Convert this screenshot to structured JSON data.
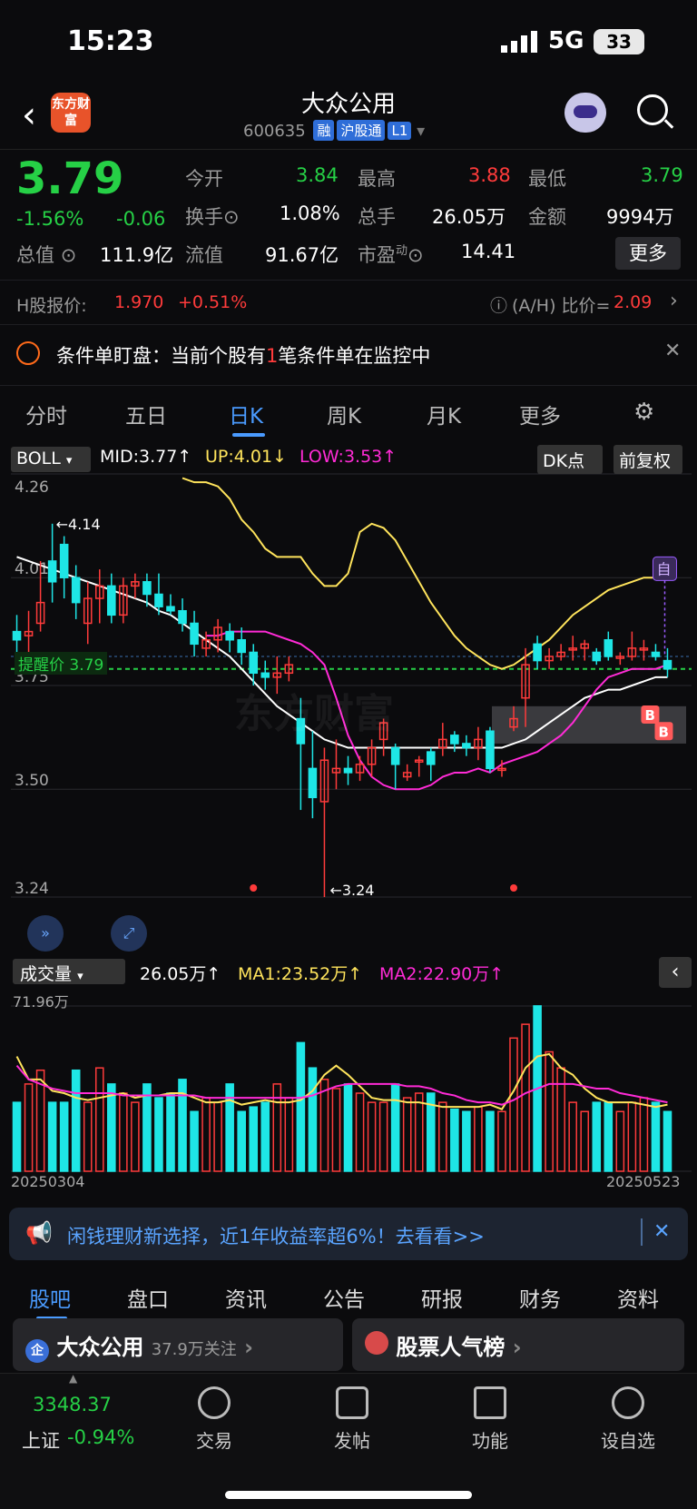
{
  "status": {
    "time": "15:23",
    "network": "5G",
    "battery": "33"
  },
  "header": {
    "logo_text": "东方财富",
    "stock_name": "大众公用",
    "stock_code": "600635",
    "tags": [
      "融",
      "沪股通",
      "L1"
    ]
  },
  "quote": {
    "price": "3.79",
    "change_pct": "-1.56%",
    "change": "-0.06",
    "open_label": "今开",
    "open": "3.84",
    "high_label": "最高",
    "high": "3.88",
    "low_label": "最低",
    "low": "3.79",
    "turnover_label": "换手",
    "turnover": "1.08%",
    "volume_label": "总手",
    "volume": "26.05万",
    "amount_label": "金额",
    "amount": "9994万",
    "mktcap_label": "总值",
    "mktcap": "111.9亿",
    "float_label": "流值",
    "float": "91.67亿",
    "pe_label": "市盈",
    "pe_sup": "动",
    "pe": "14.41",
    "more_label": "更多"
  },
  "hshare": {
    "label": "H股报价:",
    "price": "1.970",
    "change": "+0.51%",
    "ah_label": "(A/H) 比价=",
    "ah_value": "2.09"
  },
  "condition": {
    "text_a": "条件单盯盘：当前个股有",
    "count": "1",
    "text_b": "笔条件单在监控中"
  },
  "tabs": [
    "分时",
    "五日",
    "日K",
    "周K",
    "月K",
    "更多"
  ],
  "active_tab": "日K",
  "indicator": {
    "name": "BOLL",
    "mid": "MID:3.77↑",
    "up": "UP:4.01↓",
    "low": "LOW:3.53↑",
    "dk_label": "DK点",
    "fq_label": "前复权"
  },
  "alert_label": "提醒价 3.79",
  "watermark": "东方财富",
  "marks": {
    "high": "←4.14",
    "low": "←3.24",
    "self": "自",
    "buy": "B"
  },
  "volume_panel": {
    "name": "成交量",
    "vol": "26.05万↑",
    "ma1": "MA1:23.52万↑",
    "ma2": "MA2:22.90万↑",
    "max_label": "71.96万"
  },
  "dates": {
    "start": "20250304",
    "end": "20250523"
  },
  "colors": {
    "up": "#ff3b3b",
    "down": "#1ee6e6",
    "mid": "#ffffff",
    "upper": "#ffe45c",
    "lower": "#ff2bd6"
  },
  "chart_data": {
    "type": "candlestick",
    "yticks": [
      "4.26",
      "4.01",
      "3.75",
      "3.50",
      "3.24"
    ],
    "ylim": [
      3.24,
      4.26
    ],
    "candles": [
      [
        3.88,
        3.86,
        3.92,
        3.8
      ],
      [
        3.87,
        3.88,
        3.93,
        3.8
      ],
      [
        3.9,
        3.95,
        4.05,
        3.88
      ],
      [
        4.05,
        4.0,
        4.14,
        3.95
      ],
      [
        4.09,
        4.01,
        4.11,
        3.96
      ],
      [
        4.01,
        3.95,
        4.04,
        3.91
      ],
      [
        3.9,
        3.96,
        4.0,
        3.85
      ],
      [
        3.96,
        3.99,
        4.03,
        3.9
      ],
      [
        3.99,
        3.92,
        4.02,
        3.9
      ],
      [
        3.92,
        3.99,
        4.01,
        3.9
      ],
      [
        3.99,
        4.0,
        4.02,
        3.96
      ],
      [
        4.0,
        3.97,
        4.02,
        3.94
      ],
      [
        3.97,
        3.94,
        4.02,
        3.92
      ],
      [
        3.94,
        3.93,
        3.97,
        3.92
      ],
      [
        3.93,
        3.9,
        3.96,
        3.88
      ],
      [
        3.9,
        3.85,
        3.93,
        3.82
      ],
      [
        3.84,
        3.86,
        3.88,
        3.82
      ],
      [
        3.86,
        3.89,
        3.91,
        3.83
      ],
      [
        3.88,
        3.86,
        3.9,
        3.83
      ],
      [
        3.86,
        3.83,
        3.89,
        3.8
      ],
      [
        3.83,
        3.78,
        3.85,
        3.75
      ],
      [
        3.78,
        3.77,
        3.81,
        3.74
      ],
      [
        3.77,
        3.78,
        3.82,
        3.73
      ],
      [
        3.78,
        3.8,
        3.82,
        3.76
      ],
      [
        3.67,
        3.61,
        3.72,
        3.45
      ],
      [
        3.55,
        3.48,
        3.64,
        3.43
      ],
      [
        3.47,
        3.57,
        3.6,
        3.24
      ],
      [
        3.54,
        3.55,
        3.62,
        3.5
      ],
      [
        3.55,
        3.54,
        3.58,
        3.51
      ],
      [
        3.54,
        3.56,
        3.58,
        3.52
      ],
      [
        3.56,
        3.6,
        3.62,
        3.53
      ],
      [
        3.62,
        3.66,
        3.67,
        3.58
      ],
      [
        3.6,
        3.56,
        3.61,
        3.5
      ],
      [
        3.53,
        3.54,
        3.56,
        3.52
      ],
      [
        3.57,
        3.57,
        3.58,
        3.53
      ],
      [
        3.59,
        3.56,
        3.6,
        3.52
      ],
      [
        3.6,
        3.62,
        3.66,
        3.58
      ],
      [
        3.63,
        3.61,
        3.64,
        3.59
      ],
      [
        3.61,
        3.6,
        3.63,
        3.58
      ],
      [
        3.6,
        3.62,
        3.65,
        3.57
      ],
      [
        3.64,
        3.55,
        3.65,
        3.54
      ],
      [
        3.55,
        3.55,
        3.57,
        3.53
      ],
      [
        3.65,
        3.67,
        3.7,
        3.64
      ],
      [
        3.72,
        3.8,
        3.84,
        3.65
      ],
      [
        3.85,
        3.81,
        3.87,
        3.79
      ],
      [
        3.81,
        3.82,
        3.84,
        3.79
      ],
      [
        3.82,
        3.83,
        3.85,
        3.81
      ],
      [
        3.84,
        3.84,
        3.87,
        3.81
      ],
      [
        3.84,
        3.85,
        3.86,
        3.81
      ],
      [
        3.83,
        3.81,
        3.84,
        3.8
      ],
      [
        3.86,
        3.82,
        3.88,
        3.81
      ],
      [
        3.82,
        3.82,
        3.83,
        3.8
      ],
      [
        3.82,
        3.84,
        3.88,
        3.81
      ],
      [
        3.84,
        3.84,
        3.86,
        3.81
      ],
      [
        3.83,
        3.82,
        3.85,
        3.81
      ],
      [
        3.81,
        3.79,
        3.84,
        3.77
      ]
    ],
    "mid": [
      4.06,
      4.05,
      4.04,
      4.03,
      4.02,
      4.01,
      4.0,
      3.99,
      3.98,
      3.97,
      3.96,
      3.95,
      3.93,
      3.92,
      3.9,
      3.88,
      3.86,
      3.84,
      3.82,
      3.79,
      3.76,
      3.73,
      3.7,
      3.68,
      3.66,
      3.64,
      3.62,
      3.61,
      3.6,
      3.6,
      3.6,
      3.6,
      3.6,
      3.6,
      3.6,
      3.6,
      3.6,
      3.6,
      3.6,
      3.6,
      3.6,
      3.6,
      3.61,
      3.62,
      3.64,
      3.66,
      3.68,
      3.7,
      3.72,
      3.73,
      3.74,
      3.74,
      3.75,
      3.76,
      3.77,
      3.77
    ],
    "upper": [
      4.25,
      4.24,
      4.24,
      4.23,
      4.2,
      4.15,
      4.12,
      4.08,
      4.06,
      4.06,
      4.06,
      4.02,
      3.99,
      3.99,
      4.02,
      4.12,
      4.14,
      4.13,
      4.1,
      4.05,
      4.0,
      3.95,
      3.91,
      3.87,
      3.84,
      3.82,
      3.8,
      3.79,
      3.8,
      3.82,
      3.84,
      3.86,
      3.89,
      3.92,
      3.94,
      3.96,
      3.98,
      3.99,
      4.0,
      4.01,
      4.01,
      4.01
    ],
    "lower": [
      3.87,
      3.87,
      3.88,
      3.88,
      3.88,
      3.88,
      3.87,
      3.86,
      3.85,
      3.83,
      3.8,
      3.72,
      3.63,
      3.57,
      3.53,
      3.51,
      3.5,
      3.5,
      3.5,
      3.51,
      3.53,
      3.54,
      3.54,
      3.55,
      3.54,
      3.56,
      3.57,
      3.58,
      3.59,
      3.61,
      3.63,
      3.66,
      3.7,
      3.74,
      3.77,
      3.78,
      3.79,
      3.79,
      3.79,
      3.8
    ],
    "volumes": [
      30,
      38,
      44,
      30,
      30,
      44,
      30,
      45,
      38,
      34,
      30,
      38,
      32,
      34,
      40,
      26,
      32,
      30,
      38,
      26,
      28,
      30,
      38,
      32,
      56,
      45,
      40,
      36,
      38,
      34,
      30,
      30,
      38,
      32,
      34,
      34,
      30,
      27,
      26,
      28,
      26,
      26,
      58,
      64,
      72,
      52,
      45,
      30,
      26,
      30,
      30,
      26,
      30,
      32,
      30,
      26
    ],
    "ma1": [
      50,
      40,
      40,
      35,
      34,
      32,
      31,
      32,
      33,
      34,
      32,
      33,
      33,
      34,
      34,
      32,
      30,
      30,
      31,
      29,
      30,
      31,
      30,
      30,
      31,
      35,
      42,
      46,
      42,
      37,
      32,
      31,
      31,
      30,
      30,
      29,
      28,
      28,
      28,
      28,
      29,
      27,
      35,
      45,
      50,
      51,
      45,
      42,
      36,
      32,
      30,
      30,
      30,
      29,
      28,
      29
    ],
    "ma2": [
      46,
      40,
      38,
      36,
      35,
      34,
      34,
      34,
      34,
      33,
      33,
      33,
      33,
      33,
      33,
      33,
      32,
      32,
      32,
      32,
      32,
      32,
      32,
      32,
      32,
      33,
      35,
      37,
      38,
      38,
      38,
      38,
      38,
      37,
      37,
      36,
      34,
      33,
      31,
      30,
      30,
      29,
      31,
      34,
      36,
      38,
      38,
      38,
      37,
      36,
      36,
      34,
      33,
      32,
      31,
      30
    ],
    "vol_max": 71.96
  },
  "banner": {
    "text": "闲钱理财新选择，近1年收益率超6%！去看看>>"
  },
  "bottom_tabs": [
    "股吧",
    "盘口",
    "资讯",
    "公告",
    "研报",
    "财务",
    "资料"
  ],
  "cards": [
    {
      "title": "大众公用",
      "sub": "37.9万关注"
    },
    {
      "title": "股票人气榜",
      "sub": ""
    }
  ],
  "index": {
    "value": "3348.37",
    "name": "上证",
    "change": "-0.94%"
  },
  "nav": [
    "交易",
    "发帖",
    "功能",
    "设自选"
  ]
}
